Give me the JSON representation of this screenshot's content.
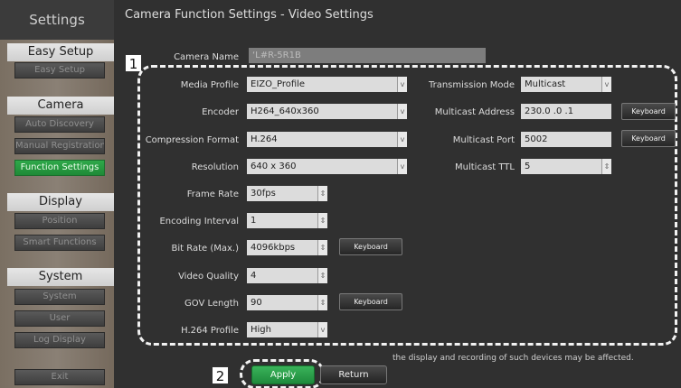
{
  "sidebar": {
    "title": "Settings",
    "sections": {
      "easy_setup": "Easy Setup",
      "camera": "Camera",
      "display": "Display",
      "system": "System"
    },
    "buttons": {
      "easy_setup": "Easy Setup",
      "auto_discovery": "Auto Discovery",
      "manual_registration": "Manual Registration",
      "function_settings": "Function Settings",
      "position": "Position",
      "smart_functions": "Smart Functions",
      "system": "System",
      "user": "User",
      "log_display": "Log Display",
      "exit": "Exit"
    }
  },
  "main": {
    "title": "Camera Function Settings - Video Settings",
    "camera_name_label": "Camera Name",
    "camera_name_value": "‘L#R-5R1B",
    "left_fields": {
      "media_profile": {
        "label": "Media Profile",
        "value": "EIZO_Profile"
      },
      "encoder": {
        "label": "Encoder",
        "value": "H264_640x360"
      },
      "compression_format": {
        "label": "Compression Format",
        "value": "H.264"
      },
      "resolution": {
        "label": "Resolution",
        "value": "640 x 360"
      },
      "frame_rate": {
        "label": "Frame Rate",
        "value": "30fps"
      },
      "encoding_interval": {
        "label": "Encoding Interval",
        "value": "1"
      },
      "bit_rate": {
        "label": "Bit Rate (Max.)",
        "value": "4096kbps"
      },
      "video_quality": {
        "label": "Video Quality",
        "value": "4"
      },
      "gov_length": {
        "label": "GOV Length",
        "value": "90"
      },
      "h264_profile": {
        "label": "H.264 Profile",
        "value": "High"
      }
    },
    "right_fields": {
      "transmission_mode": {
        "label": "Transmission Mode",
        "value": "Multicast"
      },
      "multicast_address": {
        "label": "Multicast Address",
        "value": "230.0  .0  .1"
      },
      "multicast_port": {
        "label": "Multicast Port",
        "value": "5002"
      },
      "multicast_ttl": {
        "label": "Multicast TTL",
        "value": "5"
      }
    },
    "keyboard_label": "Keyboard",
    "note": "the display and recording of such devices may be affected.",
    "apply_label": "Apply",
    "return_label": "Return",
    "badge_1": "1",
    "badge_2": "2"
  },
  "icons": {
    "dropdown": "chevron-down-icon",
    "spinner": "spin-arrows-icon"
  },
  "colors": {
    "accent_green": "#2fa84a",
    "annotation_white": "#f2f2f2"
  }
}
